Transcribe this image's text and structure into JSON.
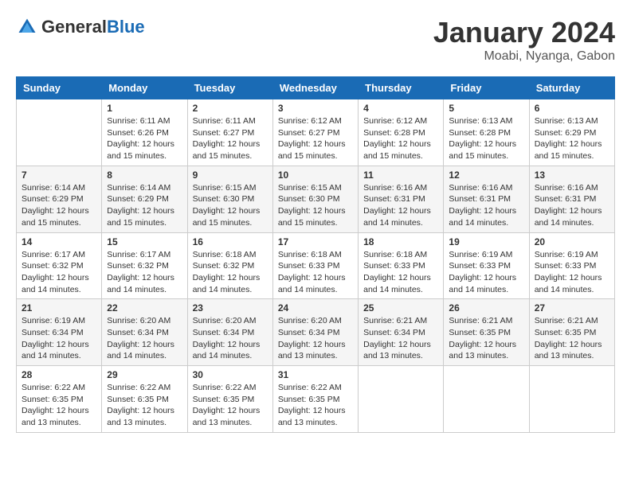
{
  "header": {
    "logo_general": "General",
    "logo_blue": "Blue",
    "title": "January 2024",
    "subtitle": "Moabi, Nyanga, Gabon"
  },
  "calendar": {
    "days_of_week": [
      "Sunday",
      "Monday",
      "Tuesday",
      "Wednesday",
      "Thursday",
      "Friday",
      "Saturday"
    ],
    "weeks": [
      [
        {
          "day": "",
          "info": ""
        },
        {
          "day": "1",
          "info": "Sunrise: 6:11 AM\nSunset: 6:26 PM\nDaylight: 12 hours and 15 minutes."
        },
        {
          "day": "2",
          "info": "Sunrise: 6:11 AM\nSunset: 6:27 PM\nDaylight: 12 hours and 15 minutes."
        },
        {
          "day": "3",
          "info": "Sunrise: 6:12 AM\nSunset: 6:27 PM\nDaylight: 12 hours and 15 minutes."
        },
        {
          "day": "4",
          "info": "Sunrise: 6:12 AM\nSunset: 6:28 PM\nDaylight: 12 hours and 15 minutes."
        },
        {
          "day": "5",
          "info": "Sunrise: 6:13 AM\nSunset: 6:28 PM\nDaylight: 12 hours and 15 minutes."
        },
        {
          "day": "6",
          "info": "Sunrise: 6:13 AM\nSunset: 6:29 PM\nDaylight: 12 hours and 15 minutes."
        }
      ],
      [
        {
          "day": "7",
          "info": "Sunrise: 6:14 AM\nSunset: 6:29 PM\nDaylight: 12 hours and 15 minutes."
        },
        {
          "day": "8",
          "info": "Sunrise: 6:14 AM\nSunset: 6:29 PM\nDaylight: 12 hours and 15 minutes."
        },
        {
          "day": "9",
          "info": "Sunrise: 6:15 AM\nSunset: 6:30 PM\nDaylight: 12 hours and 15 minutes."
        },
        {
          "day": "10",
          "info": "Sunrise: 6:15 AM\nSunset: 6:30 PM\nDaylight: 12 hours and 15 minutes."
        },
        {
          "day": "11",
          "info": "Sunrise: 6:16 AM\nSunset: 6:31 PM\nDaylight: 12 hours and 14 minutes."
        },
        {
          "day": "12",
          "info": "Sunrise: 6:16 AM\nSunset: 6:31 PM\nDaylight: 12 hours and 14 minutes."
        },
        {
          "day": "13",
          "info": "Sunrise: 6:16 AM\nSunset: 6:31 PM\nDaylight: 12 hours and 14 minutes."
        }
      ],
      [
        {
          "day": "14",
          "info": "Sunrise: 6:17 AM\nSunset: 6:32 PM\nDaylight: 12 hours and 14 minutes."
        },
        {
          "day": "15",
          "info": "Sunrise: 6:17 AM\nSunset: 6:32 PM\nDaylight: 12 hours and 14 minutes."
        },
        {
          "day": "16",
          "info": "Sunrise: 6:18 AM\nSunset: 6:32 PM\nDaylight: 12 hours and 14 minutes."
        },
        {
          "day": "17",
          "info": "Sunrise: 6:18 AM\nSunset: 6:33 PM\nDaylight: 12 hours and 14 minutes."
        },
        {
          "day": "18",
          "info": "Sunrise: 6:18 AM\nSunset: 6:33 PM\nDaylight: 12 hours and 14 minutes."
        },
        {
          "day": "19",
          "info": "Sunrise: 6:19 AM\nSunset: 6:33 PM\nDaylight: 12 hours and 14 minutes."
        },
        {
          "day": "20",
          "info": "Sunrise: 6:19 AM\nSunset: 6:33 PM\nDaylight: 12 hours and 14 minutes."
        }
      ],
      [
        {
          "day": "21",
          "info": "Sunrise: 6:19 AM\nSunset: 6:34 PM\nDaylight: 12 hours and 14 minutes."
        },
        {
          "day": "22",
          "info": "Sunrise: 6:20 AM\nSunset: 6:34 PM\nDaylight: 12 hours and 14 minutes."
        },
        {
          "day": "23",
          "info": "Sunrise: 6:20 AM\nSunset: 6:34 PM\nDaylight: 12 hours and 14 minutes."
        },
        {
          "day": "24",
          "info": "Sunrise: 6:20 AM\nSunset: 6:34 PM\nDaylight: 12 hours and 13 minutes."
        },
        {
          "day": "25",
          "info": "Sunrise: 6:21 AM\nSunset: 6:34 PM\nDaylight: 12 hours and 13 minutes."
        },
        {
          "day": "26",
          "info": "Sunrise: 6:21 AM\nSunset: 6:35 PM\nDaylight: 12 hours and 13 minutes."
        },
        {
          "day": "27",
          "info": "Sunrise: 6:21 AM\nSunset: 6:35 PM\nDaylight: 12 hours and 13 minutes."
        }
      ],
      [
        {
          "day": "28",
          "info": "Sunrise: 6:22 AM\nSunset: 6:35 PM\nDaylight: 12 hours and 13 minutes."
        },
        {
          "day": "29",
          "info": "Sunrise: 6:22 AM\nSunset: 6:35 PM\nDaylight: 12 hours and 13 minutes."
        },
        {
          "day": "30",
          "info": "Sunrise: 6:22 AM\nSunset: 6:35 PM\nDaylight: 12 hours and 13 minutes."
        },
        {
          "day": "31",
          "info": "Sunrise: 6:22 AM\nSunset: 6:35 PM\nDaylight: 12 hours and 13 minutes."
        },
        {
          "day": "",
          "info": ""
        },
        {
          "day": "",
          "info": ""
        },
        {
          "day": "",
          "info": ""
        }
      ]
    ]
  }
}
